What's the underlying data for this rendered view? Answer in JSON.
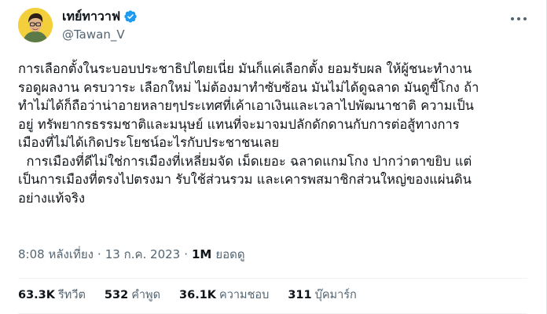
{
  "author": {
    "display_name": "เทย์ทาวาฟ",
    "handle": "@Tawan_V",
    "verified": true,
    "avatar_icon": "profile-photo",
    "verified_icon": "verified-badge-icon",
    "verified_color": "#1d9bf0"
  },
  "tweet": {
    "lines": [
      "การเลือกตั้งในระบอบประชาธิปไตยเนี่ย มันก็แค่เลือกตั้ง ยอมรับผล ให้ผู้ชนะทำงาน",
      "รอดูผลงาน ครบวาระ เลือกใหม่ ไม่ต้องมาทำซับซ้อน มันไม่ได้ดูฉลาด มันดูขี้โกง ถ้า",
      "ทำไม่ได้ก็ถือว่าน่าอายหลายๆประเทศที่เค้าเอาเงินและเวลาไปพัฒนาชาติ ความเป็น",
      "อยู่ ทรัพยากรธรรมชาติและมนุษย์ แทนที่จะมาจมปลักดักดานกับการต่อสู้ทางการ",
      "เมืองที่ไม่ได้เกิดประโยชน์อะไรกับประชาชนเลย",
      "  การเมืองที่ดีไม่ใช่การเมืองที่เหลี่ยมจัด เม็ดเยอะ ฉลาดแกมโกง ปากว่าตาขยิบ แต่",
      "เป็นการเมืองที่ตรงไปตรงมา รับใช้ส่วนรวม และเคารพสมาชิกส่วนใหญ่ของแผ่นดิน",
      "อย่างแท้จริง"
    ]
  },
  "meta": {
    "time": "8:08 หลังเที่ยง",
    "separator": "·",
    "date": "13 ก.ค. 2023",
    "views_count": "1M",
    "views_label": "ยอดดู"
  },
  "stats": {
    "retweets": {
      "count": "63.3K",
      "label": "รีทวีต"
    },
    "quotes": {
      "count": "532",
      "label": "คำพูด"
    },
    "likes": {
      "count": "36.1K",
      "label": "ความชอบ"
    },
    "bookmarks": {
      "count": "311",
      "label": "บุ๊คมาร์ก"
    }
  },
  "more_icon": "more-horizontal-icon"
}
